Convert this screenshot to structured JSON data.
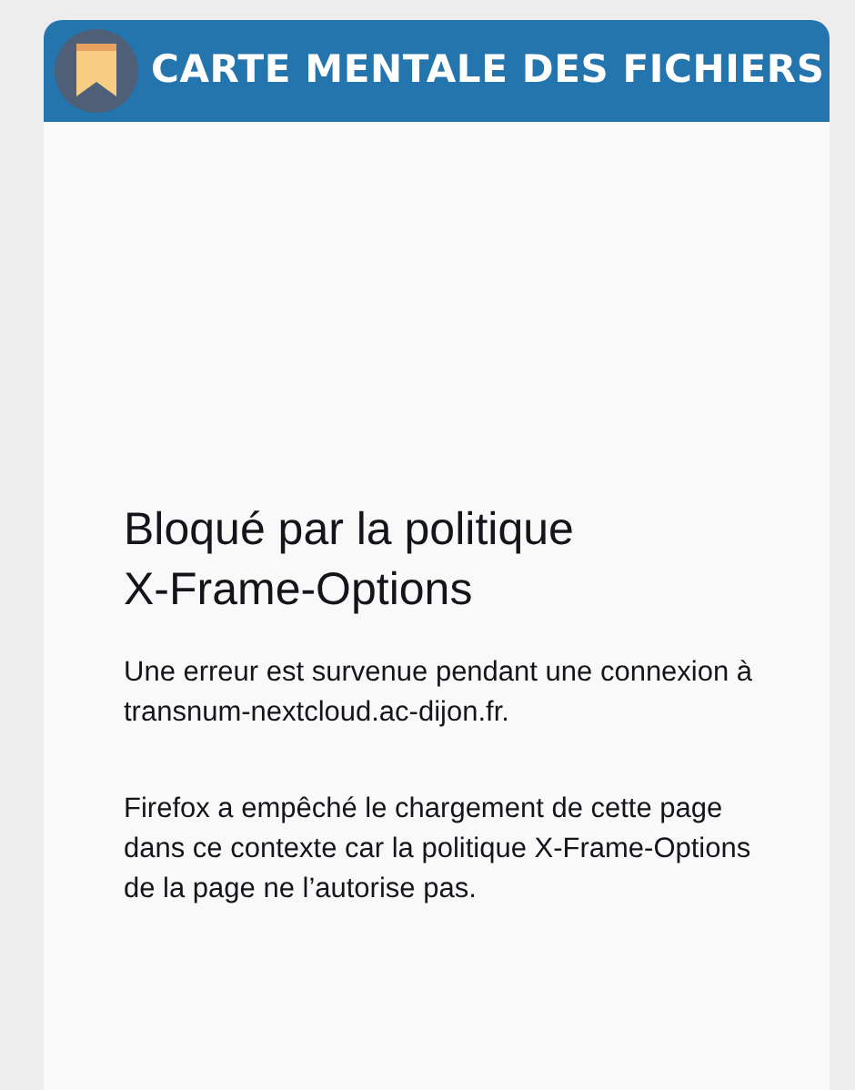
{
  "header": {
    "title": "CARTE MENTALE DES FICHIERS"
  },
  "error": {
    "title_lines": [
      "Bloqué par la politique",
      "X-Frame-Options"
    ],
    "paragraphs": [
      "Une erreur est survenue pendant une connexion à transnum-nextcloud.ac-dijon.fr.",
      "Firefox a empêché le chargement de cette page dans ce contexte car la politique X-Frame-Options de la page ne l’autorise pas."
    ]
  }
}
